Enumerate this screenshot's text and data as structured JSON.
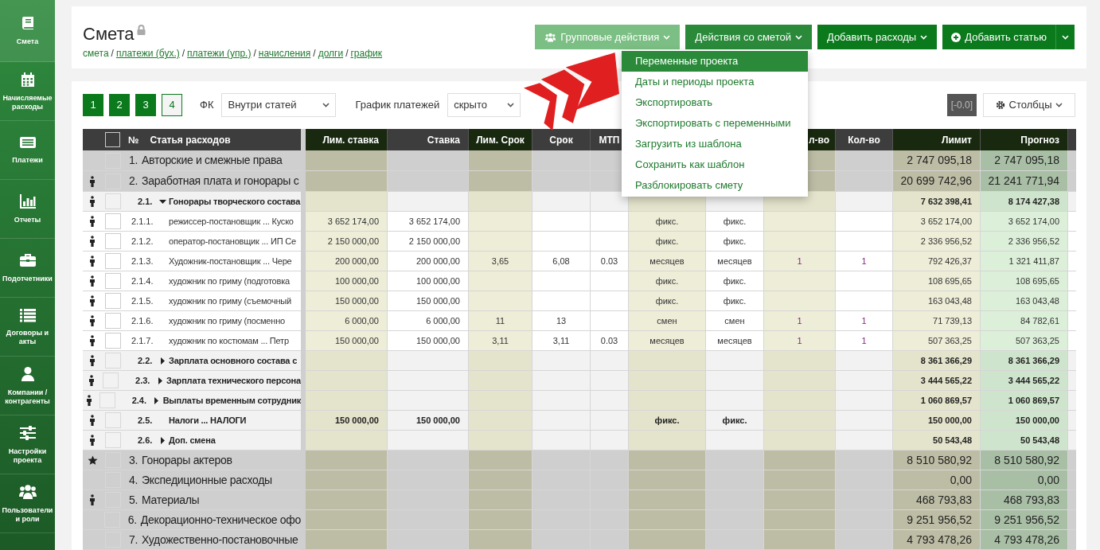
{
  "sidebar": {
    "items": [
      {
        "label": "Смета",
        "selected": true
      },
      {
        "label": "Начисляемые расходы",
        "selected": false
      },
      {
        "label": "Платежи",
        "selected": false
      },
      {
        "label": "Отчеты",
        "selected": false
      },
      {
        "label": "Подотчетники",
        "selected": false
      },
      {
        "label": "Договоры и акты",
        "selected": false
      },
      {
        "label": "Компании / контрагенты",
        "selected": false
      },
      {
        "label": "Настройки проекта",
        "selected": false
      },
      {
        "label": "Пользователи и роли",
        "selected": false
      }
    ]
  },
  "header": {
    "title": "Смета",
    "locked": true,
    "breadcrumbs": [
      {
        "kind": "link",
        "label": "смета"
      },
      {
        "kind": "separator",
        "label": "/"
      },
      {
        "kind": "underlined",
        "label": "платежи (бух.)"
      },
      {
        "kind": "separator",
        "label": "/"
      },
      {
        "kind": "underlined",
        "label": "платежи (упр.)"
      },
      {
        "kind": "separator",
        "label": "/"
      },
      {
        "kind": "underlined",
        "label": "начисления"
      },
      {
        "kind": "separator",
        "label": "/"
      },
      {
        "kind": "underlined",
        "label": "долги"
      },
      {
        "kind": "separator",
        "label": "/"
      },
      {
        "kind": "underlined",
        "label": "график"
      }
    ],
    "buttons": [
      {
        "label": "Групповые действия",
        "kind": "faded"
      },
      {
        "label": "Действия со сметой",
        "kind": "open"
      },
      {
        "label": "Добавить расходы",
        "kind": "solid"
      },
      {
        "label": "Добавить статью",
        "kind": "split"
      }
    ]
  },
  "menu": {
    "items": [
      {
        "label": "Переменные проекта",
        "selected": true
      },
      {
        "label": "Даты и периоды проекта",
        "selected": false
      },
      {
        "label": "Экспортировать",
        "selected": false
      },
      {
        "label": "Экспортировать с переменными",
        "selected": false
      },
      {
        "label": "Загрузить из шаблона",
        "selected": false
      },
      {
        "label": "Сохранить как шаблон",
        "selected": false
      },
      {
        "label": "Разблокировать смету",
        "selected": false
      }
    ]
  },
  "toolbar": {
    "levels": [
      {
        "label": "1",
        "selected": false
      },
      {
        "label": "2",
        "selected": false
      },
      {
        "label": "3",
        "selected": false
      },
      {
        "label": "4",
        "selected": true
      }
    ],
    "filters": [
      {
        "label": "ФК",
        "value": "Внутри статей"
      },
      {
        "label": "График платежей",
        "value": "скрыто"
      }
    ],
    "badge": "[-0.0]",
    "columns_button": "Столбцы"
  },
  "table": {
    "select_all": {
      "checked": false
    },
    "number_header": "№",
    "name_header": "Статья расходов",
    "columns": [
      {
        "label": "Лим. ставка",
        "kind": "limit"
      },
      {
        "label": "Ставка",
        "kind": "plain"
      },
      {
        "label": "Лим. Срок",
        "kind": "limit"
      },
      {
        "label": "Срок",
        "kind": "plain"
      },
      {
        "label": "МТП",
        "kind": "plain"
      },
      {
        "kind": "limit"
      },
      {
        "kind": "plain"
      },
      {
        "label": "л-во",
        "kind": "limit"
      },
      {
        "label": "Кол-во",
        "kind": "plain"
      },
      {
        "label": "Лимит",
        "kind": "limit"
      },
      {
        "label": "Прогноз",
        "kind": "forecast"
      }
    ],
    "rows": [
      {
        "kind": "top",
        "person": false,
        "starred": false,
        "checked": false,
        "number": "1.",
        "name": "Авторские и смежные права",
        "cells": [
          null,
          null,
          null,
          null,
          null,
          null,
          null,
          null,
          null,
          "2 747 095,18",
          "2 747 095,18"
        ]
      },
      {
        "kind": "top",
        "person": true,
        "starred": false,
        "checked": false,
        "number": "2.",
        "name": "Заработная плата и гонорары с",
        "cells": [
          null,
          null,
          null,
          null,
          null,
          null,
          null,
          null,
          null,
          "20 699 742,96",
          "21 241 771,94"
        ]
      },
      {
        "kind": "group",
        "person": true,
        "starred": false,
        "checked": false,
        "number": "2.1.",
        "expanded": true,
        "name": "Гонорары творческого состава",
        "cells": [
          null,
          null,
          null,
          null,
          null,
          null,
          null,
          null,
          null,
          "7 632 398,41",
          "8 174 427,38"
        ]
      },
      {
        "kind": "leaf",
        "person": true,
        "starred": false,
        "checked": false,
        "number": "2.1.1.",
        "name": "режиссер-постановщик ... Куско",
        "cells": [
          "3 652 174,00",
          "3 652 174,00",
          null,
          null,
          null,
          "фикс.",
          "фикс.",
          null,
          null,
          "3 652 174,00",
          "3 652 174,00"
        ]
      },
      {
        "kind": "leaf",
        "person": true,
        "starred": false,
        "checked": false,
        "number": "2.1.2.",
        "name": "оператор-постановщик ... ИП Се",
        "cells": [
          "2 150 000,00",
          "2 150 000,00",
          null,
          null,
          null,
          "фикс.",
          "фикс.",
          null,
          null,
          "2 336 956,52",
          "2 336 956,52"
        ]
      },
      {
        "kind": "leaf",
        "person": true,
        "starred": false,
        "checked": false,
        "number": "2.1.3.",
        "name": "Художник-постановщик ... Чере",
        "cells": [
          "200 000,00",
          "200 000,00",
          "3,65",
          "6,08",
          "0.03",
          "месяцев",
          "месяцев",
          "1",
          "1",
          "792 426,37",
          "1 321 411,87"
        ]
      },
      {
        "kind": "leaf",
        "person": true,
        "starred": false,
        "checked": false,
        "number": "2.1.4.",
        "name": "художник по гриму (подготовка",
        "cells": [
          "100 000,00",
          "100 000,00",
          null,
          null,
          null,
          "фикс.",
          "фикс.",
          null,
          null,
          "108 695,65",
          "108 695,65"
        ]
      },
      {
        "kind": "leaf",
        "person": true,
        "starred": false,
        "checked": false,
        "number": "2.1.5.",
        "name": "художник по гриму (съемочный",
        "cells": [
          "150 000,00",
          "150 000,00",
          null,
          null,
          null,
          "фикс.",
          "фикс.",
          null,
          null,
          "163 043,48",
          "163 043,48"
        ]
      },
      {
        "kind": "leaf",
        "person": true,
        "starred": false,
        "checked": false,
        "number": "2.1.6.",
        "name": "художник по гриму (посменно",
        "cells": [
          "6 000,00",
          "6 000,00",
          "11",
          "13",
          null,
          "смен",
          "смен",
          "1",
          "1",
          "71 739,13",
          "84 782,61"
        ]
      },
      {
        "kind": "leaf",
        "person": true,
        "starred": false,
        "checked": false,
        "number": "2.1.7.",
        "name": "художник по костюмам ... Петр",
        "cells": [
          "150 000,00",
          "150 000,00",
          "3,11",
          "3,11",
          "0.03",
          "месяцев",
          "месяцев",
          "1",
          "1",
          "507 363,25",
          "507 363,25"
        ]
      },
      {
        "kind": "group",
        "person": true,
        "starred": false,
        "checked": false,
        "number": "2.2.",
        "expanded": false,
        "name": "Зарплата основного состава с",
        "cells": [
          null,
          null,
          null,
          null,
          null,
          null,
          null,
          null,
          null,
          "8 361 366,29",
          "8 361 366,29"
        ]
      },
      {
        "kind": "group",
        "person": true,
        "starred": false,
        "checked": false,
        "number": "2.3.",
        "expanded": false,
        "name": "Зарплата технического персона",
        "cells": [
          null,
          null,
          null,
          null,
          null,
          null,
          null,
          null,
          null,
          "3 444 565,22",
          "3 444 565,22"
        ]
      },
      {
        "kind": "group",
        "person": true,
        "starred": false,
        "checked": false,
        "number": "2.4.",
        "expanded": false,
        "name": "Выплаты временным сотрудник",
        "cells": [
          null,
          null,
          null,
          null,
          null,
          null,
          null,
          null,
          null,
          "1 060 869,57",
          "1 060 869,57"
        ]
      },
      {
        "kind": "group",
        "person": true,
        "starred": false,
        "checked": false,
        "number": "2.5.",
        "name": "Налоги ... НАЛОГИ",
        "cells": [
          "150 000,00",
          "150 000,00",
          null,
          null,
          null,
          "фикс.",
          "фикс.",
          null,
          null,
          "150 000,00",
          "150 000,00"
        ]
      },
      {
        "kind": "group",
        "person": true,
        "starred": false,
        "checked": false,
        "number": "2.6.",
        "expanded": false,
        "name": "Доп. смена",
        "cells": [
          null,
          null,
          null,
          null,
          null,
          null,
          null,
          null,
          null,
          "50 543,48",
          "50 543,48"
        ]
      },
      {
        "kind": "top",
        "person": false,
        "starred": true,
        "checked": false,
        "number": "3.",
        "name": "Гонорары актеров",
        "cells": [
          null,
          null,
          null,
          null,
          null,
          null,
          null,
          null,
          null,
          "8 510 580,92",
          "8 510 580,92"
        ]
      },
      {
        "kind": "top",
        "person": false,
        "starred": false,
        "checked": false,
        "number": "4.",
        "name": "Экспедиционные расходы",
        "cells": [
          null,
          null,
          null,
          null,
          null,
          null,
          null,
          null,
          null,
          "0,00",
          "0,00"
        ]
      },
      {
        "kind": "top",
        "person": true,
        "starred": false,
        "checked": false,
        "number": "5.",
        "name": "Материалы",
        "cells": [
          null,
          null,
          null,
          null,
          null,
          null,
          null,
          null,
          null,
          "468 793,83",
          "468 793,83"
        ]
      },
      {
        "kind": "top",
        "person": false,
        "starred": false,
        "checked": false,
        "number": "6.",
        "name": "Декорационно-техническое офо",
        "cells": [
          null,
          null,
          null,
          null,
          null,
          null,
          null,
          null,
          null,
          "9 251 956,52",
          "9 251 956,52"
        ]
      },
      {
        "kind": "top",
        "person": false,
        "starred": false,
        "checked": false,
        "number": "7.",
        "name": "Художественно-постановочные",
        "cells": [
          null,
          null,
          null,
          null,
          null,
          null,
          null,
          null,
          null,
          "4 793 478,26",
          "4 793 478,26"
        ]
      }
    ]
  }
}
